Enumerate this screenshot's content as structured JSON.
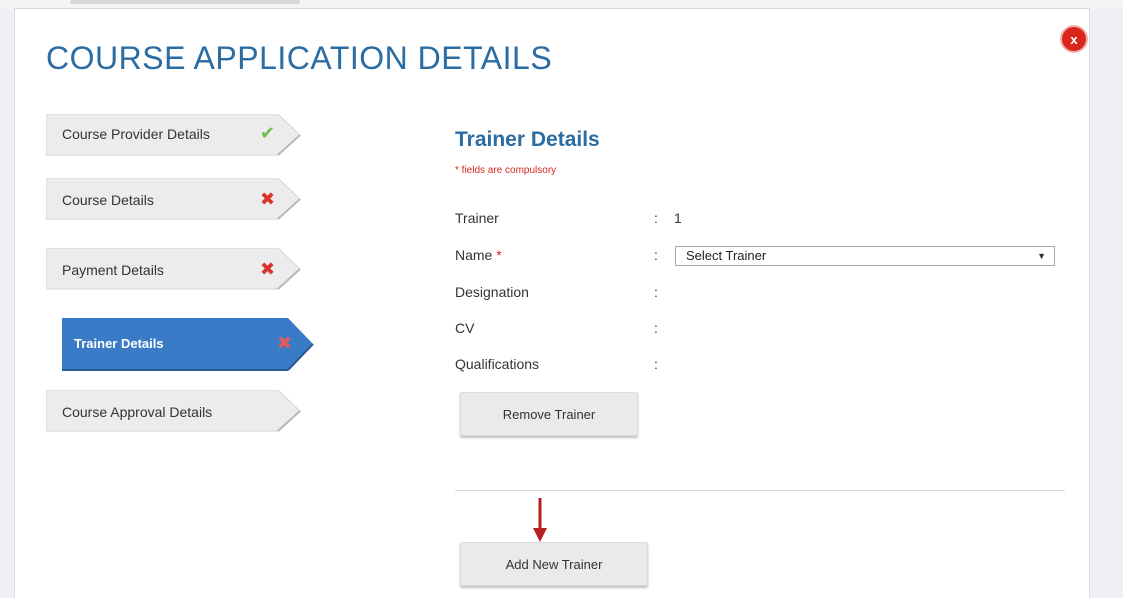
{
  "modal": {
    "title": "COURSE APPLICATION DETAILS",
    "close_label": "x"
  },
  "steps": [
    {
      "label": "Course Provider Details",
      "status": "complete",
      "status_symbol": "✔"
    },
    {
      "label": "Course Details",
      "status": "incomplete",
      "status_symbol": "✖"
    },
    {
      "label": "Payment Details",
      "status": "incomplete",
      "status_symbol": "✖"
    },
    {
      "label": "Trainer Details",
      "status": "active",
      "status_symbol": "✖"
    },
    {
      "label": "Course Approval Details",
      "status": "pending",
      "status_symbol": ""
    }
  ],
  "form": {
    "title": "Trainer Details",
    "required_note": "* fields are compulsory",
    "fields": [
      {
        "label": "Trainer",
        "value": "1"
      },
      {
        "label": "Name",
        "required_star": "*",
        "select_value": "Select Trainer"
      },
      {
        "label": "Designation",
        "value": ""
      },
      {
        "label": "CV",
        "value": ""
      },
      {
        "label": "Qualifications",
        "value": ""
      }
    ],
    "colon": ":",
    "remove_button": "Remove Trainer",
    "add_button": "Add New Trainer"
  },
  "colors": {
    "accent": "#2b6ca3",
    "active_step": "#3a7bc8",
    "step_bg": "#ececec",
    "ok": "#6cbf4a",
    "error": "#d9342b",
    "annotation_arrow": "#b52020"
  }
}
